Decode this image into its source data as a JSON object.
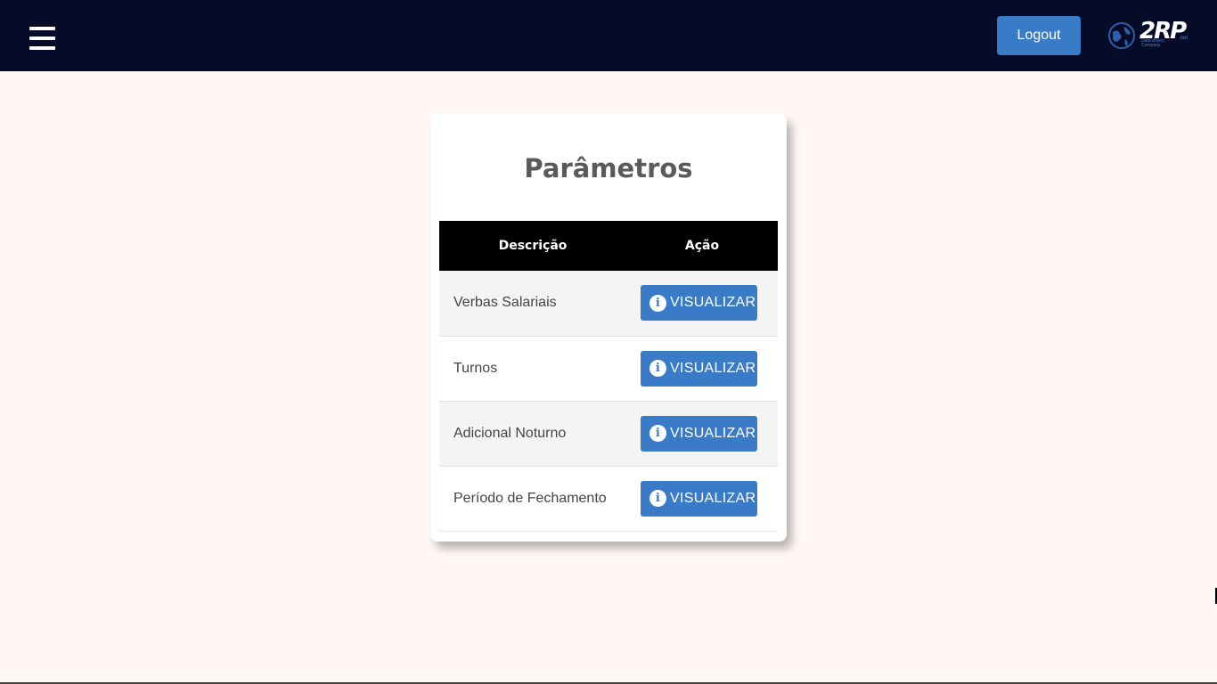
{
  "navbar": {
    "logout_label": "Logout",
    "logo_text": "2RP",
    "logo_tagline": "Data-driven Company",
    "logo_suffix": ".net"
  },
  "card": {
    "title": "Parâmetros"
  },
  "table": {
    "headers": [
      "Descrição",
      "Ação"
    ],
    "rows": [
      {
        "description": "Verbas Salariais",
        "action_label": "VISUALIZAR"
      },
      {
        "description": "Turnos",
        "action_label": "VISUALIZAR"
      },
      {
        "description": "Adicional Noturno",
        "action_label": "VISUALIZAR"
      },
      {
        "description": "Período de Fechamento",
        "action_label": "VISUALIZAR"
      }
    ]
  },
  "icons": {
    "menu": "hamburger-menu-icon",
    "info": "info-icon",
    "logo": "globe-icon"
  },
  "colors": {
    "navbar": "#060b28",
    "accent": "#3a7bc8",
    "page_bg": "#fff8f7",
    "table_header": "#000000"
  }
}
